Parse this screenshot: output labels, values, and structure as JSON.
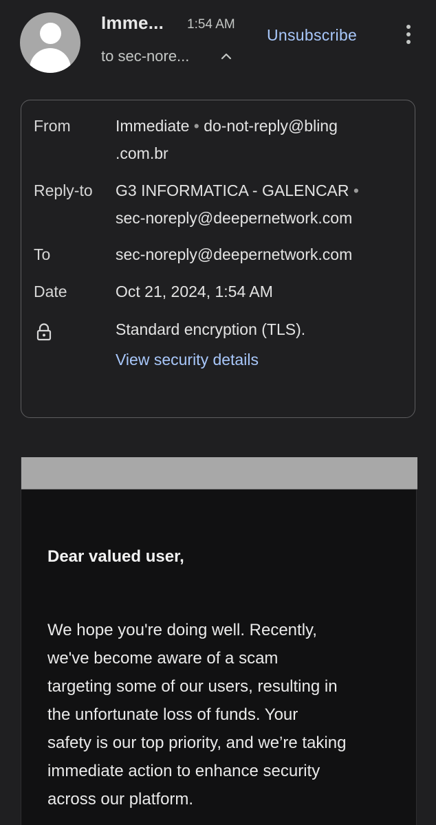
{
  "header": {
    "sender_name": "Imme...",
    "time": "1:54 AM",
    "to_line": "to sec-nore...",
    "unsubscribe_label": "Unsubscribe"
  },
  "details": {
    "from_label": "From",
    "from_name": "Immediate",
    "from_separator": "•",
    "from_email_part1": "do-not-reply@bling",
    "from_email_part2": ".com.br",
    "replyto_label": "Reply-to",
    "replyto_name": "G3 INFORMATICA - GALENCAR",
    "replyto_separator": "•",
    "replyto_email": "sec-noreply@deepernetwork.com",
    "to_label": "To",
    "to_email": "sec-noreply@deepernetwork.com",
    "date_label": "Date",
    "date_value": "Oct 21, 2024, 1:54 AM",
    "encryption_text": "Standard encryption (TLS).",
    "security_link": "View security details"
  },
  "email_body": {
    "greeting": "Dear valued user,",
    "paragraph_lines": [
      "We hope you're doing well. Recently,",
      "we've become aware of a scam",
      "targeting some of our users, resulting in",
      "the unfortunate loss of funds. Your",
      "safety is our top priority, and we’re taking",
      "immediate action to enhance security",
      "across our platform."
    ]
  },
  "icons": {
    "avatar": "person-avatar-icon",
    "chevron": "chevron-up-icon",
    "more": "more-vert-icon",
    "lock": "lock-icon"
  },
  "colors": {
    "background": "#1f1f21",
    "link": "#a8c7fa",
    "avatar": "#a8a8a8",
    "email_body_bg": "#111112"
  }
}
